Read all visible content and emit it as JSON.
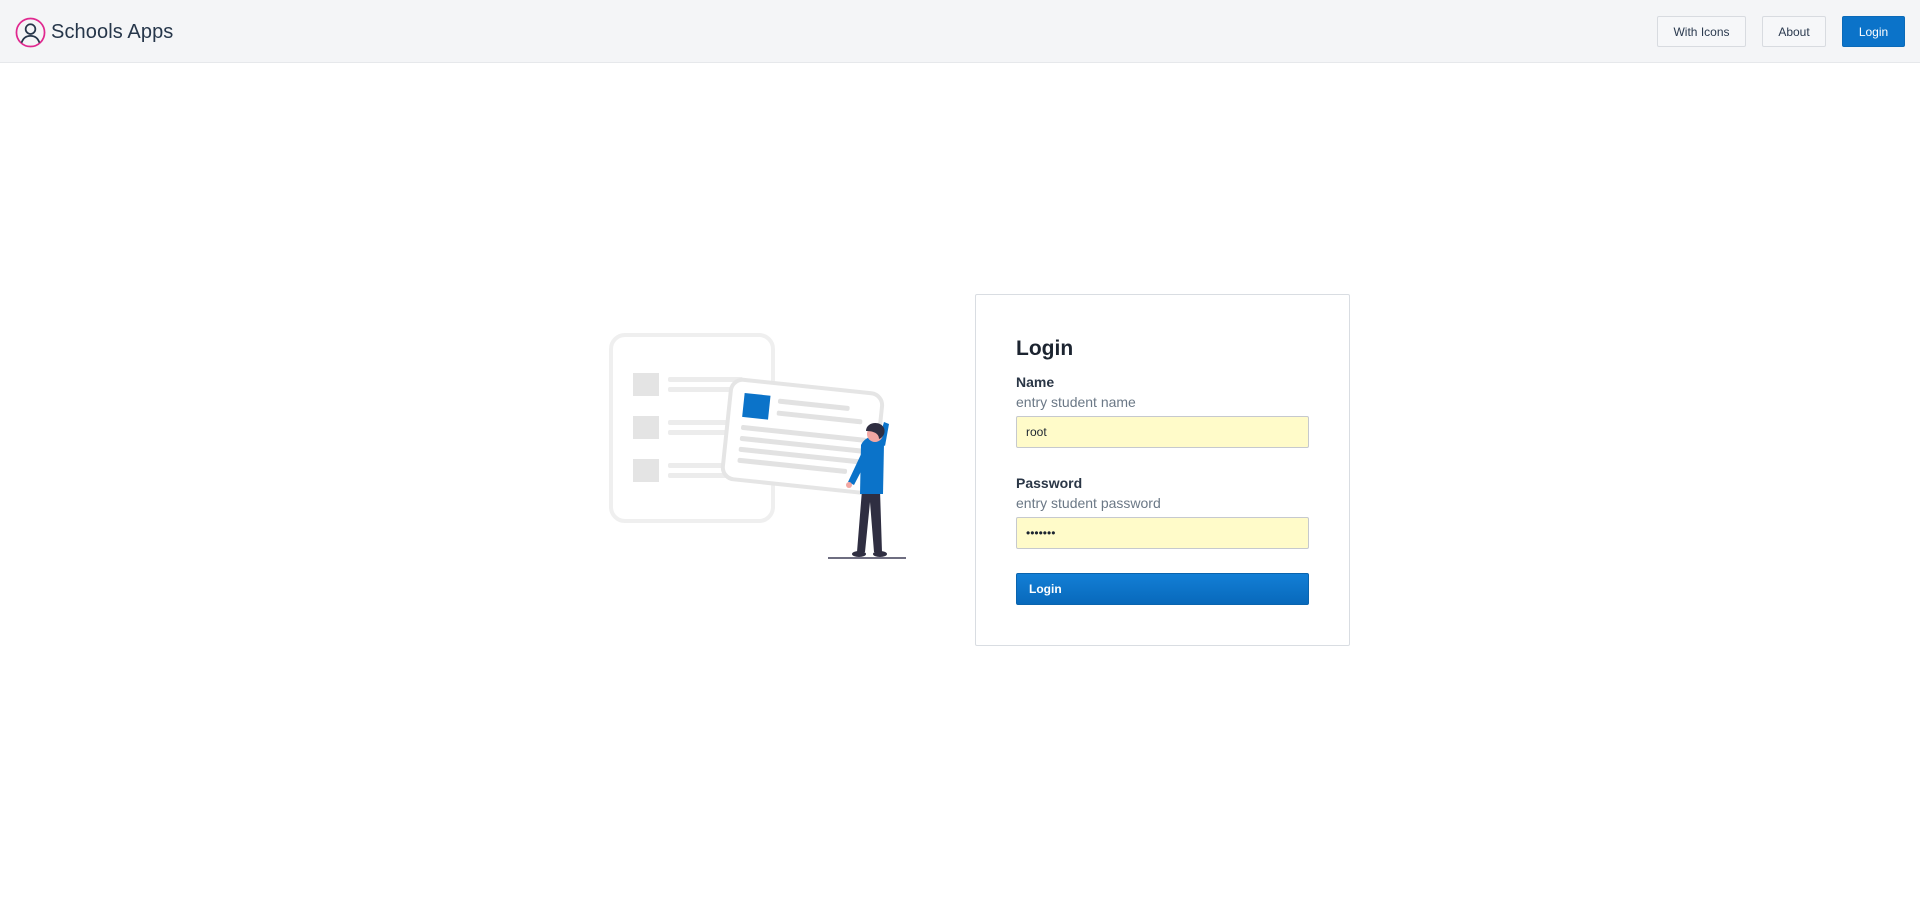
{
  "navbar": {
    "brand_name": "Schools Apps",
    "brand_icon": "user-circle-icon",
    "accent_color": "#e0288f",
    "buttons": {
      "with_icons": "With Icons",
      "about": "About",
      "login": "Login"
    }
  },
  "hero": {
    "illustration": "person-holding-document-illustration",
    "accent_color": "#0b73c9"
  },
  "login_form": {
    "title": "Login",
    "name": {
      "label": "Name",
      "hint": "entry student name",
      "value": "root"
    },
    "password": {
      "label": "Password",
      "hint": "entry student password",
      "value": "1234567"
    },
    "submit_label": "Login",
    "primary_color": "#0b73c9"
  }
}
